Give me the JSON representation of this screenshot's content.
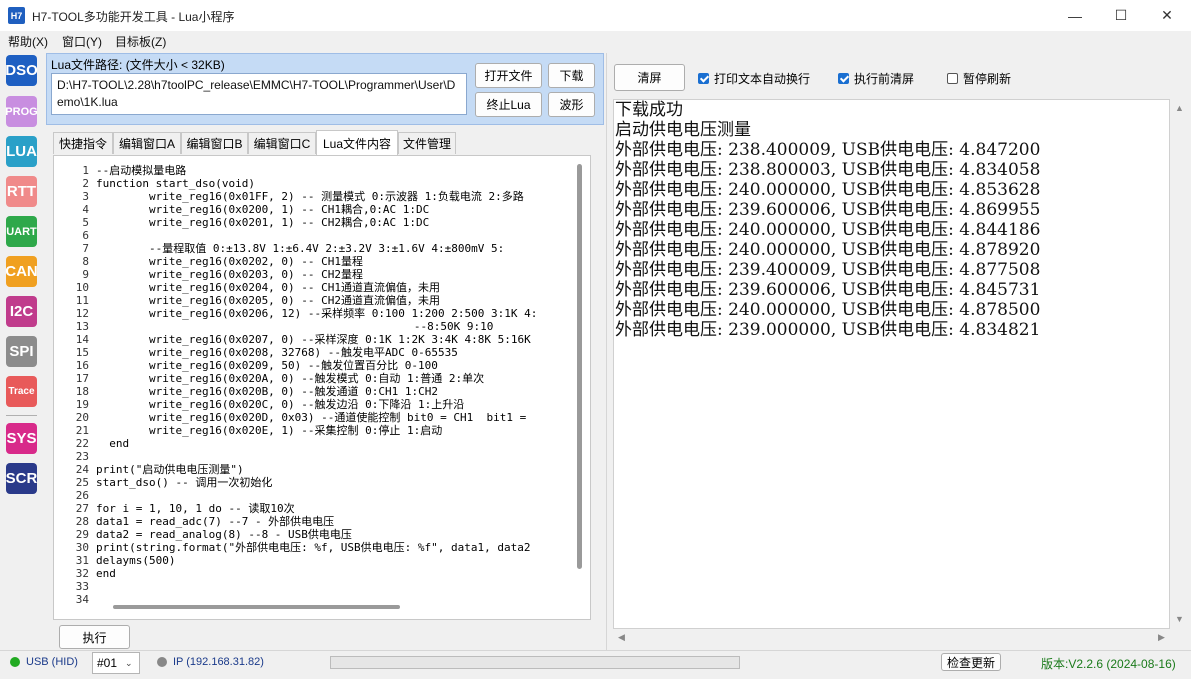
{
  "window": {
    "icon_text": "H7",
    "title": "H7-TOOL多功能开发工具 - Lua小程序",
    "minimize": "—",
    "maximize": "☐",
    "close": "✕"
  },
  "menu": [
    "帮助(X)",
    "窗口(Y)",
    "目标板(Z)"
  ],
  "sidebar": [
    {
      "label": "DSO",
      "color": "#1e5fc2"
    },
    {
      "label": "PROG",
      "color": "#c88ee0"
    },
    {
      "label": "LUA",
      "color": "#2aa0c8"
    },
    {
      "label": "RTT",
      "color": "#f08a8a"
    },
    {
      "label": "UART",
      "color": "#2ea84a"
    },
    {
      "label": "CAN",
      "color": "#f0a020"
    },
    {
      "label": "I2C",
      "color": "#c03c8c"
    },
    {
      "label": "SPI",
      "color": "#8c8c8c"
    },
    {
      "label": "Trace",
      "color": "#e85a5a"
    },
    {
      "label": "SYS",
      "color": "#d82a8a"
    },
    {
      "label": "SCR",
      "color": "#2a3a8a"
    }
  ],
  "file": {
    "label": "Lua文件路径: (文件大小 < 32KB)",
    "path": "D:\\H7-TOOL\\2.28\\h7toolPC_release\\EMMC\\H7-TOOL\\Programmer\\User\\Demo\\1K.lua",
    "open_button": "打开文件",
    "download_button": "下载",
    "stop_button": "终止Lua",
    "wave_button": "波形"
  },
  "tabs": [
    {
      "label": "快捷指令",
      "active": false
    },
    {
      "label": "编辑窗口A",
      "active": false
    },
    {
      "label": "编辑窗口B",
      "active": false
    },
    {
      "label": "编辑窗口C",
      "active": false
    },
    {
      "label": "Lua文件内容",
      "active": true
    },
    {
      "label": "文件管理",
      "active": false
    }
  ],
  "code_lines": [
    {
      "n": "1",
      "t": "--启动模拟量电路"
    },
    {
      "n": "2",
      "t": "function start_dso(void)"
    },
    {
      "n": "3",
      "t": "        write_reg16(0x01FF, 2) -- 测量模式 0:示波器 1:负载电流 2:多路"
    },
    {
      "n": "4",
      "t": "        write_reg16(0x0200, 1) -- CH1耦合,0:AC 1:DC"
    },
    {
      "n": "5",
      "t": "        write_reg16(0x0201, 1) -- CH2耦合,0:AC 1:DC"
    },
    {
      "n": "6",
      "t": ""
    },
    {
      "n": "7",
      "t": "        --量程取值 0:±13.8V 1:±6.4V 2:±3.2V 3:±1.6V 4:±800mV 5:"
    },
    {
      "n": "8",
      "t": "        write_reg16(0x0202, 0) -- CH1量程"
    },
    {
      "n": "9",
      "t": "        write_reg16(0x0203, 0) -- CH2量程"
    },
    {
      "n": "10",
      "t": "        write_reg16(0x0204, 0) -- CH1通道直流偏值，未用"
    },
    {
      "n": "11",
      "t": "        write_reg16(0x0205, 0) -- CH2通道直流偏值，未用"
    },
    {
      "n": "12",
      "t": "        write_reg16(0x0206, 12) --采样频率 0:100 1:200 2:500 3:1K 4:"
    },
    {
      "n": "13",
      "t": "                                                --8:50K 9:10"
    },
    {
      "n": "14",
      "t": "        write_reg16(0x0207, 0) --采样深度 0:1K 1:2K 3:4K 4:8K 5:16K"
    },
    {
      "n": "15",
      "t": "        write_reg16(0x0208, 32768) --触发电平ADC 0-65535"
    },
    {
      "n": "16",
      "t": "        write_reg16(0x0209, 50) --触发位置百分比 0-100"
    },
    {
      "n": "17",
      "t": "        write_reg16(0x020A, 0) --触发模式 0:自动 1:普通 2:单次"
    },
    {
      "n": "18",
      "t": "        write_reg16(0x020B, 0) --触发通道 0:CH1 1:CH2"
    },
    {
      "n": "19",
      "t": "        write_reg16(0x020C, 0) --触发边沿 0:下降沿 1:上升沿"
    },
    {
      "n": "20",
      "t": "        write_reg16(0x020D, 0x03) --通道使能控制 bit0 = CH1  bit1 ="
    },
    {
      "n": "21",
      "t": "        write_reg16(0x020E, 1) --采集控制 0:停止 1:启动"
    },
    {
      "n": "22",
      "t": "  end"
    },
    {
      "n": "23",
      "t": ""
    },
    {
      "n": "24",
      "t": "print(\"启动供电电压测量\")"
    },
    {
      "n": "25",
      "t": "start_dso() -- 调用一次初始化"
    },
    {
      "n": "26",
      "t": ""
    },
    {
      "n": "27",
      "t": "for i = 1, 10, 1 do -- 读取10次"
    },
    {
      "n": "28",
      "t": "data1 = read_adc(7) --7 - 外部供电电压"
    },
    {
      "n": "29",
      "t": "data2 = read_analog(8) --8 - USB供电电压"
    },
    {
      "n": "30",
      "t": "print(string.format(\"外部供电电压: %f, USB供电电压: %f\", data1, data2"
    },
    {
      "n": "31",
      "t": "delayms(500)"
    },
    {
      "n": "32",
      "t": "end"
    },
    {
      "n": "33",
      "t": ""
    },
    {
      "n": "34",
      "t": ""
    }
  ],
  "execute_button": "执行",
  "right": {
    "clear_button": "清屏",
    "auto_wrap_label": "打印文本自动换行",
    "auto_wrap_checked": true,
    "clear_before_exec_label": "执行前清屏",
    "clear_before_exec_checked": true,
    "pause_refresh_label": "暂停刷新",
    "pause_refresh_checked": false
  },
  "output_lines": [
    "下载成功",
    "启动供电电压测量",
    "外部供电电压: 238.400009, USB供电电压: 4.847200",
    "外部供电电压: 238.800003, USB供电电压: 4.834058",
    "外部供电电压: 240.000000, USB供电电压: 4.853628",
    "外部供电电压: 239.600006, USB供电电压: 4.869955",
    "外部供电电压: 240.000000, USB供电电压: 4.844186",
    "外部供电电压: 240.000000, USB供电电压: 4.878920",
    "外部供电电压: 239.400009, USB供电电压: 4.877508",
    "外部供电电压: 239.600006, USB供电电压: 4.845731",
    "外部供电电压: 240.000000, USB供电电压: 4.878500",
    "外部供电电压: 239.000000, USB供电电压: 4.834821"
  ],
  "status": {
    "usb_label": "USB (HID)",
    "usb_color": "#22aa22",
    "device_select": "#01",
    "ip_label": "IP (192.168.31.82)",
    "ip_color": "#888888",
    "check_update_button": "检查更新",
    "version": "版本:V2.2.6 (2024-08-16)",
    "version_color": "#1a7a1a"
  }
}
